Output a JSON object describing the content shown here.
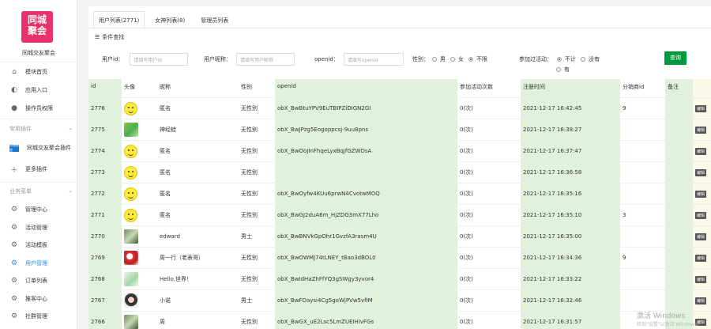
{
  "app": {
    "logo_line1": "同城",
    "logo_line2": "聚会",
    "name": "同城交友聚会"
  },
  "sidebar": {
    "top_items": [
      {
        "label": "模块首页",
        "icon": "home-icon"
      },
      {
        "label": "应用入口",
        "icon": "chat-icon"
      },
      {
        "label": "操作员权限",
        "icon": "user-icon"
      }
    ],
    "section_plugins": "常用插件",
    "plugin_item": {
      "label": "同城交友聚会插件",
      "icon_text": "同城聚会"
    },
    "more_plugins": "更多插件",
    "section_business": "业务菜单",
    "business_items": [
      {
        "label": "管理中心",
        "active": false
      },
      {
        "label": "活动管理",
        "active": false
      },
      {
        "label": "活动模板",
        "active": false
      },
      {
        "label": "用户管理",
        "active": true
      },
      {
        "label": "订单列表",
        "active": false
      },
      {
        "label": "推客中心",
        "active": false
      },
      {
        "label": "社群管理",
        "active": false
      }
    ]
  },
  "tabs": [
    {
      "label": "用户列表(2771)",
      "active": true
    },
    {
      "label": "女神列表(8)",
      "active": false
    },
    {
      "label": "管理员列表",
      "active": false
    }
  ],
  "filters": {
    "title": "条件查找",
    "user_id_label": "用户id：",
    "user_id_placeholder": "请填写用户id",
    "nickname_label": "用户昵称：",
    "nickname_placeholder": "请填写用户昵称",
    "openid_label": "openid：",
    "openid_placeholder": "请填写openid",
    "gender_label": "性别：",
    "gender_options": [
      "男",
      "女",
      "不限"
    ],
    "gender_selected": "不限",
    "joined_label": "参加过活动：",
    "joined_options": [
      "不计",
      "没有",
      "有"
    ],
    "joined_selected": "不计",
    "search_button": "查询"
  },
  "table": {
    "headers": [
      "id",
      "头像",
      "昵称",
      "性别",
      "openid",
      "参加活动次数",
      "注册时间",
      "分销商id",
      "备注"
    ],
    "edit_label": "编辑",
    "rows": [
      {
        "id": "2776",
        "avatar": "smiley",
        "nick": "匿名",
        "sex": "无性别",
        "openid": "obX_BwBtuYPV9EuTBIPZiDIGN2GI",
        "count": "0(次)",
        "time": "2021-12-17 16:42:45",
        "dist": "9",
        "note": ""
      },
      {
        "id": "2775",
        "avatar": "frog",
        "nick": "神经蛙",
        "sex": "无性别",
        "openid": "obX_BwJPzg5Eogoppcsj-9uu8pns",
        "count": "0(次)",
        "time": "2021-12-17 16:38:27",
        "dist": "",
        "note": ""
      },
      {
        "id": "2774",
        "avatar": "smiley",
        "nick": "匿名",
        "sex": "无性别",
        "openid": "obX_BwOoJInFhqeLyxBqjfGZWDsA",
        "count": "0(次)",
        "time": "2021-12-17 16:37:47",
        "dist": "",
        "note": ""
      },
      {
        "id": "2773",
        "avatar": "smiley",
        "nick": "匿名",
        "sex": "无性别",
        "openid": "",
        "count": "0(次)",
        "time": "2021-12-17 16:36:58",
        "dist": "",
        "note": ""
      },
      {
        "id": "2772",
        "avatar": "smiley",
        "nick": "匿名",
        "sex": "无性别",
        "openid": "obX_BwOyfw4KUu6prwN4CvotwMOQ",
        "count": "0(次)",
        "time": "2021-12-17 16:35:16",
        "dist": "",
        "note": ""
      },
      {
        "id": "2771",
        "avatar": "smiley",
        "nick": "匿名",
        "sex": "无性别",
        "openid": "obX_BwGJ2duA6m_HjZDG3mX77Lho",
        "count": "0(次)",
        "time": "2021-12-17 16:35:10",
        "dist": "3",
        "note": ""
      },
      {
        "id": "2770",
        "avatar": "photo-green",
        "nick": "edward",
        "sex": "男士",
        "openid": "obX_BwBNVkGpOhr1GvzfA3rasm4U",
        "count": "0(次)",
        "time": "2021-12-17 16:35:00",
        "dist": "",
        "note": ""
      },
      {
        "id": "2769",
        "avatar": "photo-red",
        "nick": "周一行（老表哥）",
        "sex": "无性别",
        "openid": "obX_BwOWMJ74tLNEY_tBao3dBOL0",
        "count": "0(次)",
        "time": "2021-12-17 16:34:36",
        "dist": "9",
        "note": ""
      },
      {
        "id": "2768",
        "avatar": "photo-light",
        "nick": "Hello,世界！",
        "sex": "无性别",
        "openid": "obX_BwIdHaZhFfYQ3gSWgy3yvor4",
        "count": "0(次)",
        "time": "2021-12-17 16:33:22",
        "dist": "",
        "note": ""
      },
      {
        "id": "2767",
        "avatar": "photo-face",
        "nick": "小诺",
        "sex": "男士",
        "openid": "obX_BwFDaysi4Cg5goWjPVw5vfIM",
        "count": "0(次)",
        "time": "2021-12-17 16:32:46",
        "dist": "",
        "note": ""
      },
      {
        "id": "2766",
        "avatar": "photo-green",
        "nick": "周",
        "sex": "无性别",
        "openid": "obX_BwGX_uE2Lsc5LmZUEIHIvFGs",
        "count": "0(次)",
        "time": "2021-12-17 16:31:57",
        "dist": "",
        "note": ""
      }
    ]
  },
  "watermark": {
    "line1": "激活 Windows",
    "line2": "转到\"设置\"以激活 Windows。"
  },
  "colors": {
    "logo": "#e8336a",
    "active": "#2d8cf0",
    "search_button": "#009a3e",
    "column_green": "#e1f2dc"
  }
}
